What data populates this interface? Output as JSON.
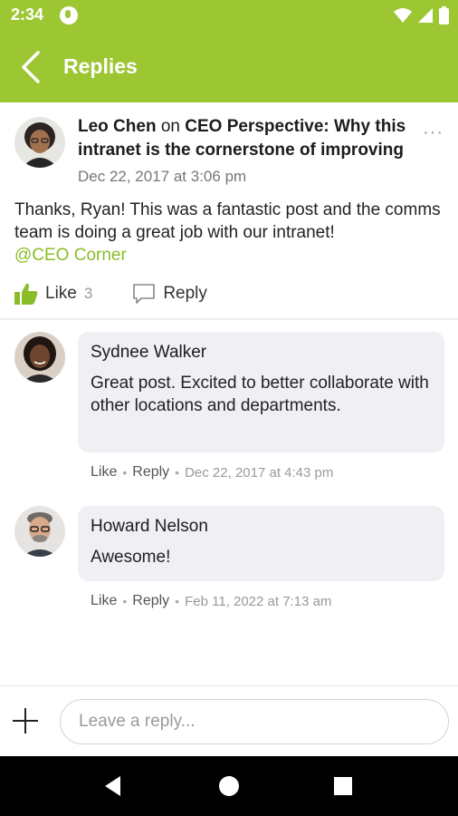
{
  "status_bar": {
    "time": "2:34"
  },
  "app_bar": {
    "title": "Replies"
  },
  "post": {
    "author": "Leo Chen",
    "on_word": "on",
    "topic": "CEO Perspective: Why this intranet is the cornerstone of improving",
    "date": "Dec 22, 2017 at 3:06 pm",
    "body": "Thanks, Ryan!  This was a fantastic post and the comms team is doing a great job with our intranet!",
    "mention": "@CEO Corner",
    "like_label": "Like",
    "like_count": "3",
    "reply_label": "Reply",
    "more_label": "···"
  },
  "replies": [
    {
      "author": "Sydnee Walker",
      "text": "Great post.  Excited to better collaborate with other locations and departments.",
      "like_label": "Like",
      "reply_label": "Reply",
      "date": "Dec 22, 2017 at 4:43 pm"
    },
    {
      "author": "Howard Nelson",
      "text": "Awesome!",
      "like_label": "Like",
      "reply_label": "Reply",
      "date": "Feb 11, 2022 at 7:13 am"
    }
  ],
  "composer": {
    "placeholder": "Leave a reply..."
  },
  "meta_separator": "•",
  "colors": {
    "brand": "#9dc633",
    "mention": "#8bbd28",
    "bubble": "#f0f0f4",
    "navbar": "#000000"
  }
}
